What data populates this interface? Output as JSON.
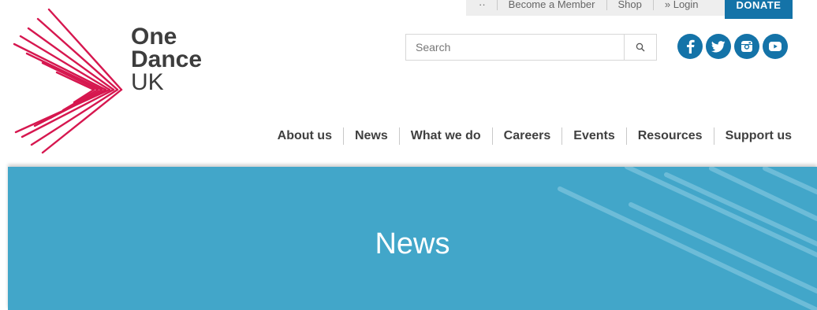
{
  "topbar": {
    "items": [
      "··",
      "Become a Member",
      "Shop",
      "» Login"
    ],
    "donate_label": "DONATE"
  },
  "logo": {
    "line1": "One",
    "line2": "Dance",
    "line3": "UK",
    "mark_color": "#d6174f"
  },
  "search": {
    "placeholder": "Search"
  },
  "social": [
    {
      "name": "facebook-icon",
      "glyph": "f"
    },
    {
      "name": "twitter-icon",
      "glyph": "t"
    },
    {
      "name": "instagram-icon",
      "glyph": "i"
    },
    {
      "name": "youtube-icon",
      "glyph": "y"
    }
  ],
  "nav": {
    "items": [
      "About us",
      "News",
      "What we do",
      "Careers",
      "Events",
      "Resources",
      "Support us"
    ]
  },
  "hero": {
    "title": "News",
    "background": "#42a6c9"
  },
  "colors": {
    "accent": "#1473a8",
    "brand": "#d6174f",
    "hero": "#42a6c9"
  }
}
